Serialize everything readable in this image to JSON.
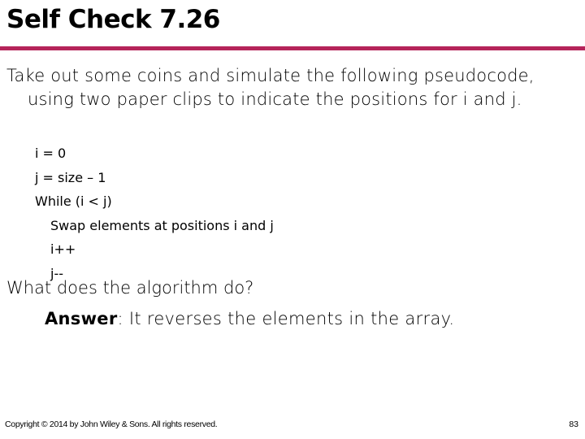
{
  "slide": {
    "title": "Self Check 7.26",
    "accent_color": "#B5245A",
    "intro": "Take out some coins and simulate the following pseudocode, using two paper clips to indicate the positions for i and j.",
    "pseudocode": [
      {
        "text": "i = 0",
        "indent": 0
      },
      {
        "text": "j = size – 1",
        "indent": 0
      },
      {
        "text": "While (i < j)",
        "indent": 0
      },
      {
        "text": "Swap elements at positions i and j",
        "indent": 1
      },
      {
        "text": "i++",
        "indent": 1
      },
      {
        "text": "j--",
        "indent": 1
      }
    ],
    "question": "What does the algorithm do?",
    "answer_label": "Answer",
    "answer_text": ": It reverses the elements in the array."
  },
  "footer": {
    "copyright": "Copyright © 2014 by John Wiley & Sons.  All rights reserved.",
    "page_number": "83"
  }
}
